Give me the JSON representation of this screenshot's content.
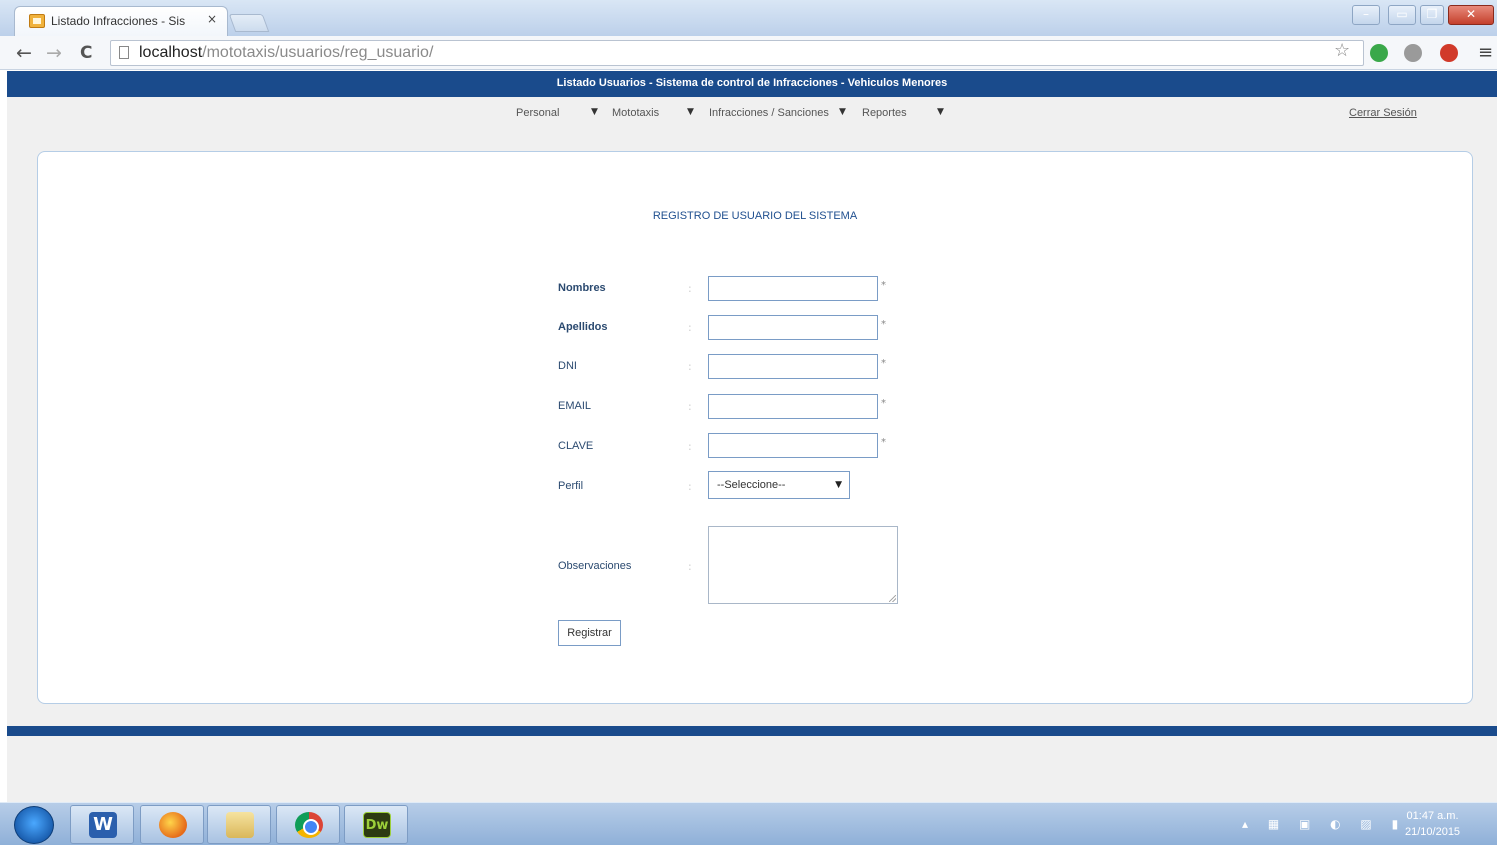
{
  "browser": {
    "tab_title": "Listado Infracciones - Sis",
    "tab_close": "×",
    "url_host": "localhost",
    "url_path": "/mototaxis/usuarios/reg_usuario/",
    "back": "←",
    "forward": "→",
    "reload": "C",
    "star": "☆",
    "menu": "≡"
  },
  "page": {
    "header_title": "Listado Usuarios - Sistema de control de Infracciones - Vehiculos Menores",
    "menu": {
      "items": [
        "Personal",
        "Mototaxis",
        "Infracciones / Sanciones",
        "Reportes"
      ],
      "arrow": "▼",
      "logout": "Cerrar Sesión"
    },
    "form": {
      "title": "REGISTRO DE USUARIO DEL SISTEMA",
      "colon": ":",
      "required_mark": "*",
      "fields": [
        {
          "label": "Nombres",
          "value": ""
        },
        {
          "label": "Apellidos",
          "value": ""
        },
        {
          "label": "DNI",
          "value": ""
        },
        {
          "label": "EMAIL",
          "value": ""
        },
        {
          "label": "CLAVE",
          "value": ""
        }
      ],
      "profile_label": "Perfil",
      "profile_selected": "--Seleccione--",
      "observations_label": "Observaciones",
      "submit_label": "Registrar"
    }
  },
  "taskbar": {
    "apps": [
      "word",
      "firefox",
      "explorer",
      "chrome",
      "dreamweaver"
    ],
    "word_glyph": "W",
    "dw_glyph": "Dw",
    "tray": "▴ ▦ ▣ ◐ ▨ ▮",
    "time": "01:47 a.m.",
    "date": "21/10/2015"
  },
  "colors": {
    "header": "#1a4b8c",
    "card_border": "#b5cde6",
    "input_border": "#7a9cc6"
  }
}
